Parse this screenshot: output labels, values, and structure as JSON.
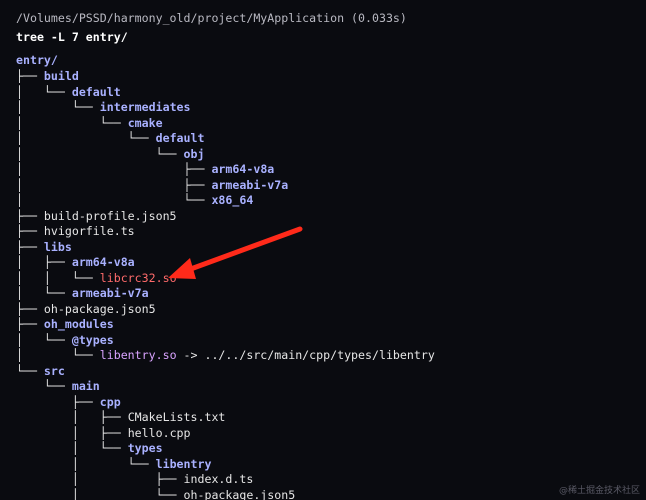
{
  "terminal": {
    "cwd_line": "/Volumes/PSSD/harmony_old/project/MyApplication (0.033s)",
    "command": "tree -L 7 entry/",
    "root": "entry/",
    "tree": [
      {
        "prefix": "├── ",
        "name": "build",
        "kind": "dir"
      },
      {
        "prefix": "│   └── ",
        "name": "default",
        "kind": "dir"
      },
      {
        "prefix": "│       └── ",
        "name": "intermediates",
        "kind": "dir"
      },
      {
        "prefix": "│           └── ",
        "name": "cmake",
        "kind": "dir"
      },
      {
        "prefix": "│               └── ",
        "name": "default",
        "kind": "dir"
      },
      {
        "prefix": "│                   └── ",
        "name": "obj",
        "kind": "dir"
      },
      {
        "prefix": "│                       ├── ",
        "name": "arm64-v8a",
        "kind": "dir"
      },
      {
        "prefix": "│                       ├── ",
        "name": "armeabi-v7a",
        "kind": "dir"
      },
      {
        "prefix": "│                       └── ",
        "name": "x86_64",
        "kind": "dir"
      },
      {
        "prefix": "├── ",
        "name": "build-profile.json5",
        "kind": "file"
      },
      {
        "prefix": "├── ",
        "name": "hvigorfile.ts",
        "kind": "file"
      },
      {
        "prefix": "├── ",
        "name": "libs",
        "kind": "dir"
      },
      {
        "prefix": "│   ├── ",
        "name": "arm64-v8a",
        "kind": "dir"
      },
      {
        "prefix": "│   │   └── ",
        "name": "libcrc32.so",
        "kind": "so"
      },
      {
        "prefix": "│   └── ",
        "name": "armeabi-v7a",
        "kind": "dir"
      },
      {
        "prefix": "├── ",
        "name": "oh-package.json5",
        "kind": "file"
      },
      {
        "prefix": "├── ",
        "name": "oh_modules",
        "kind": "dir"
      },
      {
        "prefix": "│   └── ",
        "name": "@types",
        "kind": "dir"
      },
      {
        "prefix": "│       └── ",
        "name": "libentry.so",
        "kind": "link",
        "target": " -> ../../src/main/cpp/types/libentry"
      },
      {
        "prefix": "└── ",
        "name": "src",
        "kind": "dir"
      },
      {
        "prefix": "    └── ",
        "name": "main",
        "kind": "dir"
      },
      {
        "prefix": "        ├── ",
        "name": "cpp",
        "kind": "dir"
      },
      {
        "prefix": "        │   ├── ",
        "name": "CMakeLists.txt",
        "kind": "file"
      },
      {
        "prefix": "        │   ├── ",
        "name": "hello.cpp",
        "kind": "file"
      },
      {
        "prefix": "        │   └── ",
        "name": "types",
        "kind": "dir"
      },
      {
        "prefix": "        │       └── ",
        "name": "libentry",
        "kind": "dir"
      },
      {
        "prefix": "        │           ├── ",
        "name": "index.d.ts",
        "kind": "file"
      },
      {
        "prefix": "        │           └── ",
        "name": "oh-package.json5",
        "kind": "file"
      }
    ]
  },
  "watermark": "@稀土掘金技术社区",
  "colors": {
    "background": "#0a0b10",
    "directory": "#a9b1ff",
    "shared_object": "#ff6b6b",
    "symlink": "#d9a3ff",
    "annotation_arrow": "#ff2a1a"
  }
}
